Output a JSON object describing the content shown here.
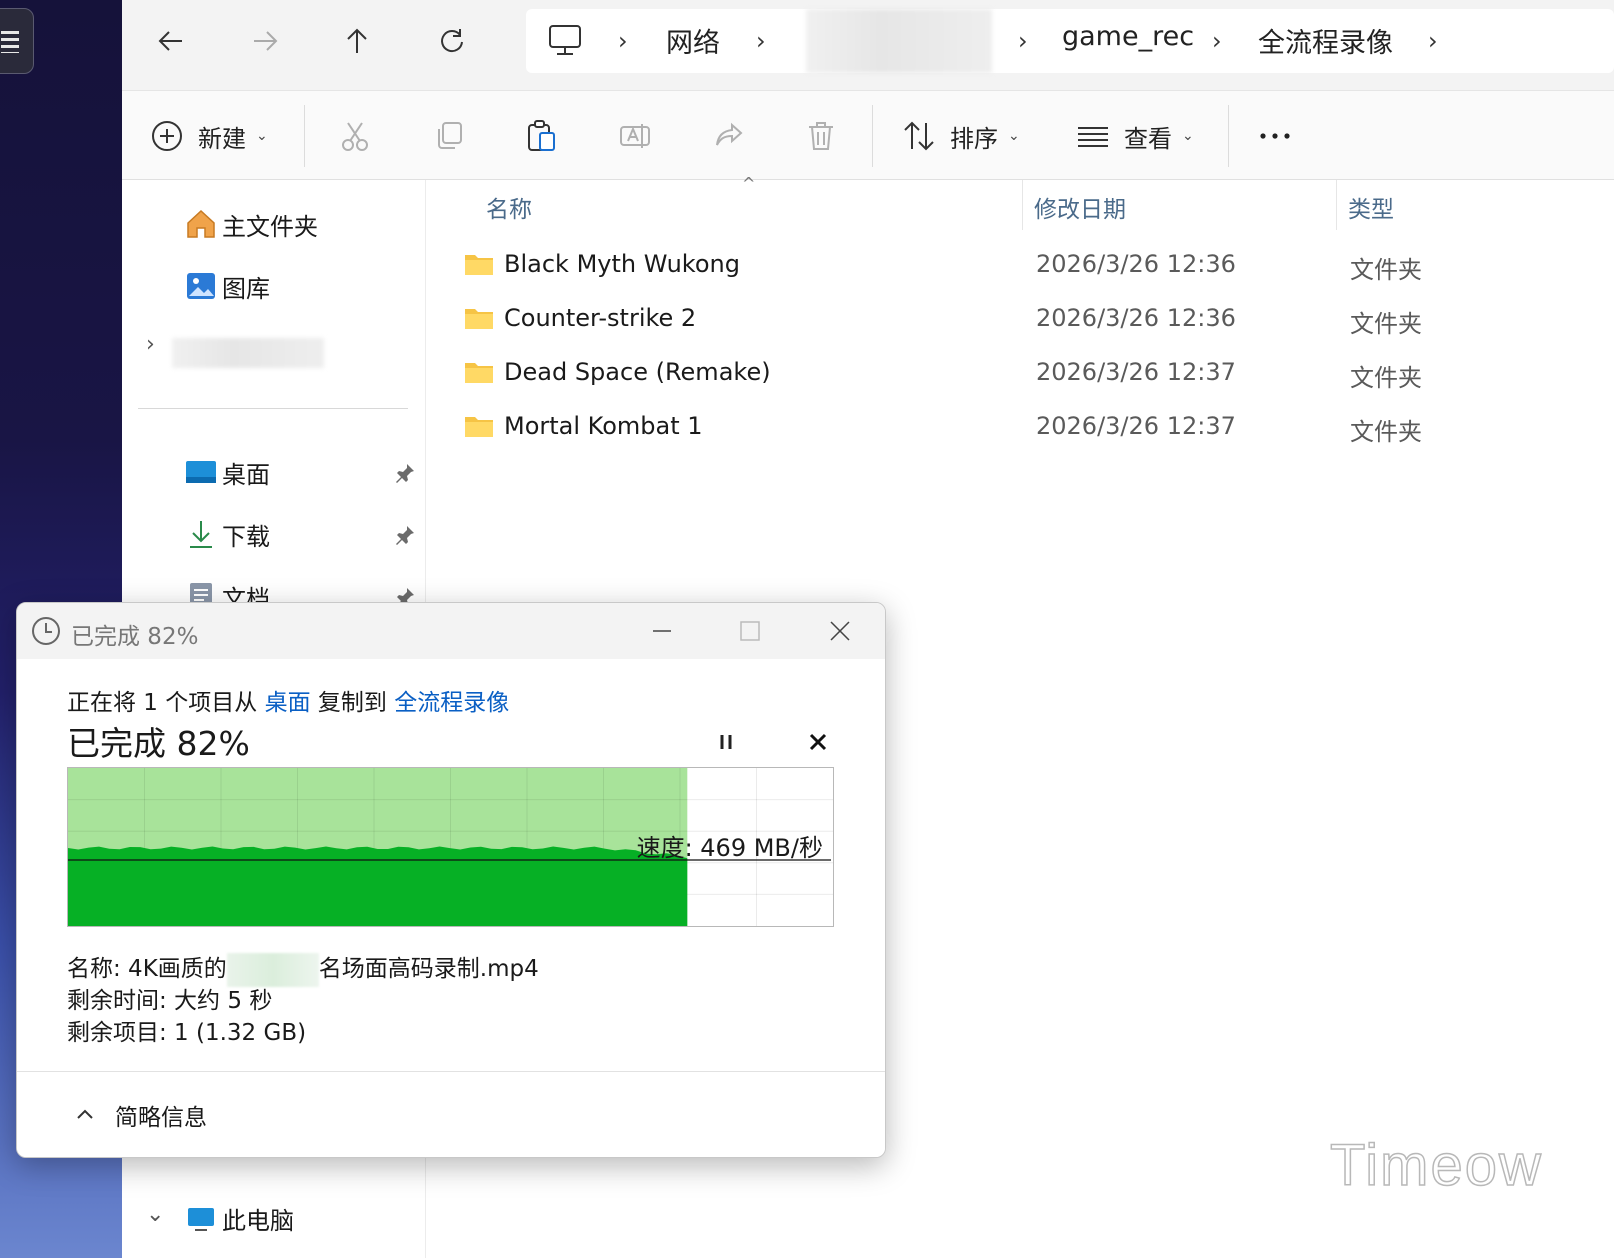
{
  "nav": {
    "back_icon": "arrow-left-icon",
    "forward_icon": "arrow-right-icon",
    "up_icon": "arrow-up-icon",
    "refresh_icon": "refresh-icon"
  },
  "breadcrumb": {
    "items": [
      "网络",
      "game_rec",
      "全流程录像"
    ]
  },
  "toolbar": {
    "new_label": "新建",
    "sort_label": "排序",
    "view_label": "查看"
  },
  "sidebar": {
    "home": "主文件夹",
    "gallery": "图库",
    "desktop": "桌面",
    "downloads": "下载",
    "documents": "文档",
    "this_pc": "此电脑"
  },
  "columns": {
    "name": "名称",
    "date": "修改日期",
    "type": "类型"
  },
  "files": [
    {
      "name": "Black Myth  Wukong",
      "date": "2026/3/26 12:36",
      "type": "文件夹"
    },
    {
      "name": "Counter-strike 2",
      "date": "2026/3/26 12:36",
      "type": "文件夹"
    },
    {
      "name": "Dead Space (Remake)",
      "date": "2026/3/26 12:37",
      "type": "文件夹"
    },
    {
      "name": "Mortal Kombat 1",
      "date": "2026/3/26 12:37",
      "type": "文件夹"
    }
  ],
  "dialog": {
    "title": "已完成 82%",
    "desc_prefix": "正在将 1 个项目从 ",
    "source": "桌面",
    "desc_mid": " 复制到 ",
    "destination": "全流程录像",
    "percent_text": "已完成 82%",
    "progress": 0.82,
    "speed": "速度: 469 MB/秒",
    "name_line_a": "名称: 4K画质的",
    "name_line_b": "名场面高码录制.mp4",
    "time_left": "剩余时间: 大约 5 秒",
    "items_left": "剩余项目: 1 (1.32 GB)",
    "details_toggle": "简略信息",
    "accent_color": "#06b025",
    "accent_light": "#a8e39a"
  },
  "watermark": "Timeow"
}
